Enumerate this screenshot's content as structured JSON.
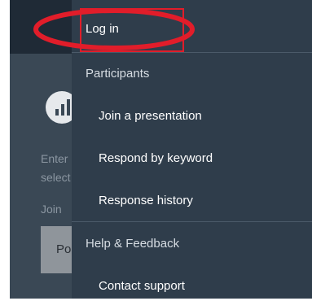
{
  "background_page": {
    "text_line_1": "Enter",
    "text_line_2": "select",
    "text_line_3": "Join",
    "button_label": "Po"
  },
  "menu": {
    "login_label": "Log in",
    "participants_section": "Participants",
    "participants_items": [
      {
        "label": "Join a presentation"
      },
      {
        "label": "Respond by keyword"
      },
      {
        "label": "Response history"
      }
    ],
    "help_section": "Help & Feedback",
    "help_items": [
      {
        "label": "Contact support"
      }
    ]
  },
  "colors": {
    "drawer_background": "#2f3d4b",
    "annotation_red": "#e11d2a"
  }
}
